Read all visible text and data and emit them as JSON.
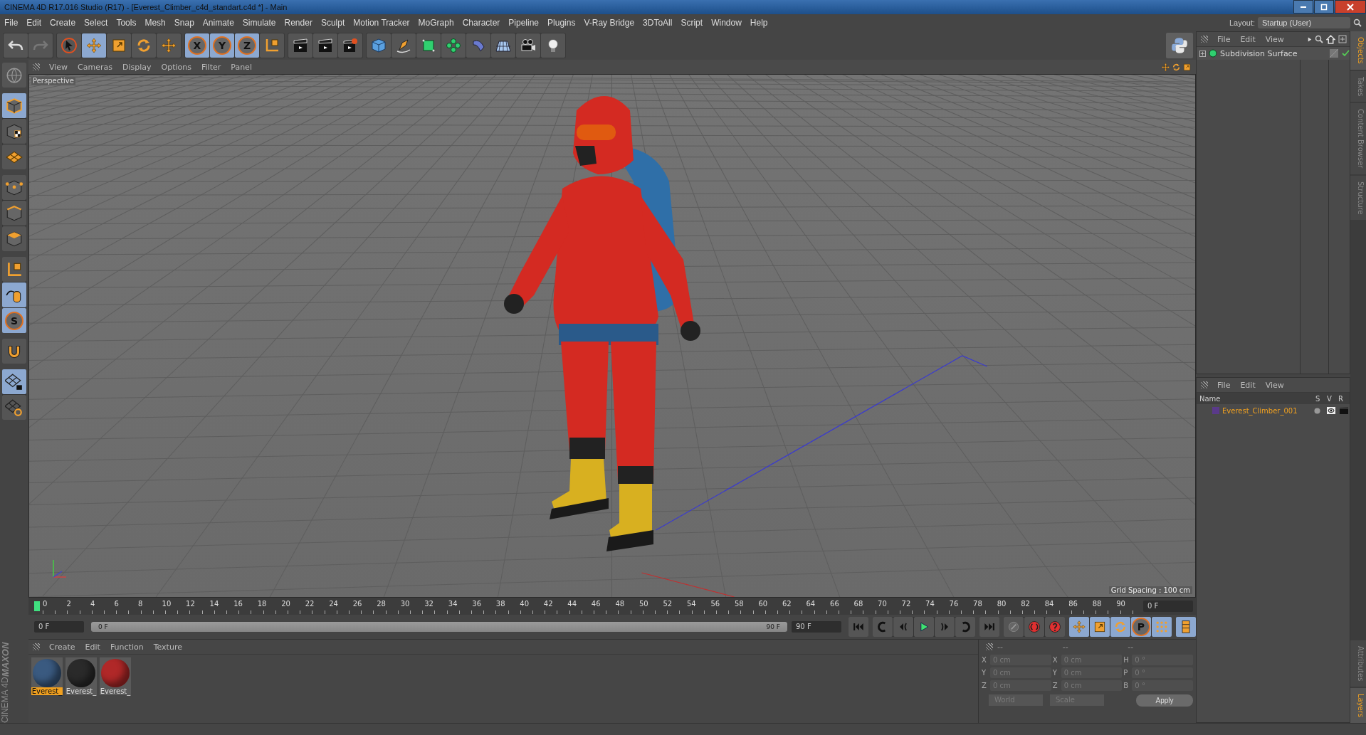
{
  "window": {
    "title": "CINEMA 4D R17.016 Studio (R17) - [Everest_Climber_c4d_standart.c4d *] - Main"
  },
  "menu": [
    "File",
    "Edit",
    "Create",
    "Select",
    "Tools",
    "Mesh",
    "Snap",
    "Animate",
    "Simulate",
    "Render",
    "Sculpt",
    "Motion Tracker",
    "MoGraph",
    "Character",
    "Pipeline",
    "Plugins",
    "V-Ray Bridge",
    "3DToAll",
    "Script",
    "Window",
    "Help"
  ],
  "layout": {
    "label": "Layout:",
    "value": "Startup (User)"
  },
  "toolbar": [
    [
      {
        "kind": "undo",
        "selected": false
      },
      {
        "kind": "redo",
        "selected": false
      }
    ],
    [
      {
        "kind": "cursor",
        "selected": false
      },
      {
        "kind": "move",
        "selected": true
      },
      {
        "kind": "scale",
        "selected": false
      },
      {
        "kind": "rotate",
        "selected": false
      },
      {
        "kind": "move",
        "selected": false
      }
    ],
    [
      {
        "kind": "axis",
        "label": "X",
        "selected": true
      },
      {
        "kind": "axis",
        "label": "Y",
        "selected": true
      },
      {
        "kind": "axis",
        "label": "Z",
        "selected": true
      },
      {
        "kind": "coord",
        "selected": false
      }
    ],
    [
      {
        "kind": "clapper",
        "selected": false
      },
      {
        "kind": "clapper",
        "selected": false
      },
      {
        "kind": "clapper-gear",
        "selected": false
      }
    ],
    [
      {
        "kind": "cube",
        "selected": false
      },
      {
        "kind": "pen",
        "selected": false
      },
      {
        "kind": "nurbs",
        "selected": false
      },
      {
        "kind": "array",
        "selected": false
      },
      {
        "kind": "deformer",
        "selected": false
      },
      {
        "kind": "floor",
        "selected": false
      },
      {
        "kind": "camera",
        "selected": false
      },
      {
        "kind": "light",
        "selected": false
      }
    ]
  ],
  "lefttools": [
    [
      {
        "kind": "globe",
        "selected": false
      }
    ],
    [
      {
        "kind": "model",
        "selected": true
      },
      {
        "kind": "texture",
        "selected": false
      },
      {
        "kind": "workplane",
        "selected": false
      }
    ],
    [
      {
        "kind": "points",
        "selected": false
      },
      {
        "kind": "edges",
        "selected": false
      },
      {
        "kind": "polygons",
        "selected": false
      }
    ],
    [
      {
        "kind": "coord",
        "selected": false
      },
      {
        "kind": "mouse",
        "selected": true
      },
      {
        "kind": "axis",
        "label": "S",
        "selected": true
      }
    ],
    [
      {
        "kind": "magnet",
        "selected": false
      }
    ],
    [
      {
        "kind": "grid-lock",
        "selected": true
      },
      {
        "kind": "grid-rotate",
        "selected": false
      }
    ]
  ],
  "viewport": {
    "menu": [
      "View",
      "Cameras",
      "Display",
      "Options",
      "Filter",
      "Panel"
    ],
    "camera": "Perspective",
    "grid_spacing": "Grid Spacing : 100 cm"
  },
  "timeline": {
    "ticks": [
      "0",
      "2",
      "4",
      "6",
      "8",
      "10",
      "12",
      "14",
      "16",
      "18",
      "20",
      "22",
      "24",
      "26",
      "28",
      "30",
      "32",
      "34",
      "36",
      "38",
      "40",
      "42",
      "44",
      "46",
      "48",
      "50",
      "52",
      "54",
      "56",
      "58",
      "60",
      "62",
      "64",
      "66",
      "68",
      "70",
      "72",
      "74",
      "76",
      "78",
      "80",
      "82",
      "84",
      "86",
      "88",
      "90"
    ],
    "current_frame": "0 F",
    "start": "0 F",
    "range": {
      "start": "0 F",
      "end": "90 F",
      "level": 1
    },
    "end": "90 F",
    "controls": [
      [
        {
          "kind": "first",
          "selected": false
        }
      ],
      [
        {
          "kind": "prev-key",
          "selected": false
        },
        {
          "kind": "prev-frame",
          "selected": false
        },
        {
          "kind": "play",
          "selected": false
        },
        {
          "kind": "next-frame",
          "selected": false
        },
        {
          "kind": "next-key",
          "selected": false
        }
      ],
      [
        {
          "kind": "last",
          "selected": false
        }
      ],
      [
        {
          "kind": "record-off",
          "selected": false
        },
        {
          "kind": "autokey",
          "selected": false
        },
        {
          "kind": "help",
          "selected": false
        }
      ],
      [
        {
          "kind": "move",
          "selected": true
        },
        {
          "kind": "scale",
          "selected": true
        },
        {
          "kind": "rotate",
          "selected": true
        },
        {
          "kind": "axis",
          "label": "P",
          "selected": true
        },
        {
          "kind": "dots",
          "selected": true
        }
      ],
      [
        {
          "kind": "film",
          "selected": true
        }
      ]
    ]
  },
  "materials": {
    "menu": [
      "Create",
      "Edit",
      "Function",
      "Texture"
    ],
    "items": [
      {
        "name": "Everest_",
        "color": "#3a5a80",
        "selected": true
      },
      {
        "name": "Everest_",
        "color": "#2a2a2a",
        "selected": false
      },
      {
        "name": "Everest_",
        "color": "#b02828",
        "selected": false
      }
    ]
  },
  "coordinates": {
    "headers": [
      "--",
      "--",
      "--"
    ],
    "rows": [
      [
        {
          "axis": "X",
          "value": "0 cm"
        },
        {
          "axis": "X",
          "value": "0 cm"
        },
        {
          "axis": "H",
          "value": "0 °"
        }
      ],
      [
        {
          "axis": "Y",
          "value": "0 cm"
        },
        {
          "axis": "Y",
          "value": "0 cm"
        },
        {
          "axis": "P",
          "value": "0 °"
        }
      ],
      [
        {
          "axis": "Z",
          "value": "0 cm"
        },
        {
          "axis": "Z",
          "value": "0 cm"
        },
        {
          "axis": "B",
          "value": "0 °"
        }
      ]
    ],
    "space": "World",
    "mode": "Scale",
    "apply": "Apply",
    "disabled": true
  },
  "objects": {
    "menu": [
      "File",
      "Edit",
      "View"
    ],
    "items": [
      {
        "name": "Subdivision Surface"
      }
    ]
  },
  "layers": {
    "menu": [
      "File",
      "Edit",
      "View"
    ],
    "columns": [
      "Name",
      "S",
      "V",
      "R"
    ],
    "items": [
      {
        "name": "Everest_Climber_001",
        "color": "#5a3a8a"
      }
    ]
  },
  "side_tabs_top": [
    {
      "label": "Objects",
      "selected": true
    },
    {
      "label": "Takes",
      "selected": false
    },
    {
      "label": "Content Browser",
      "selected": false
    },
    {
      "label": "Structure",
      "selected": false
    }
  ],
  "side_tabs_bottom": [
    {
      "label": "Attributes",
      "selected": false
    },
    {
      "label": "Layers",
      "selected": true
    }
  ],
  "brand": {
    "line1": "MAXON",
    "line2": "CINEMA 4D"
  }
}
